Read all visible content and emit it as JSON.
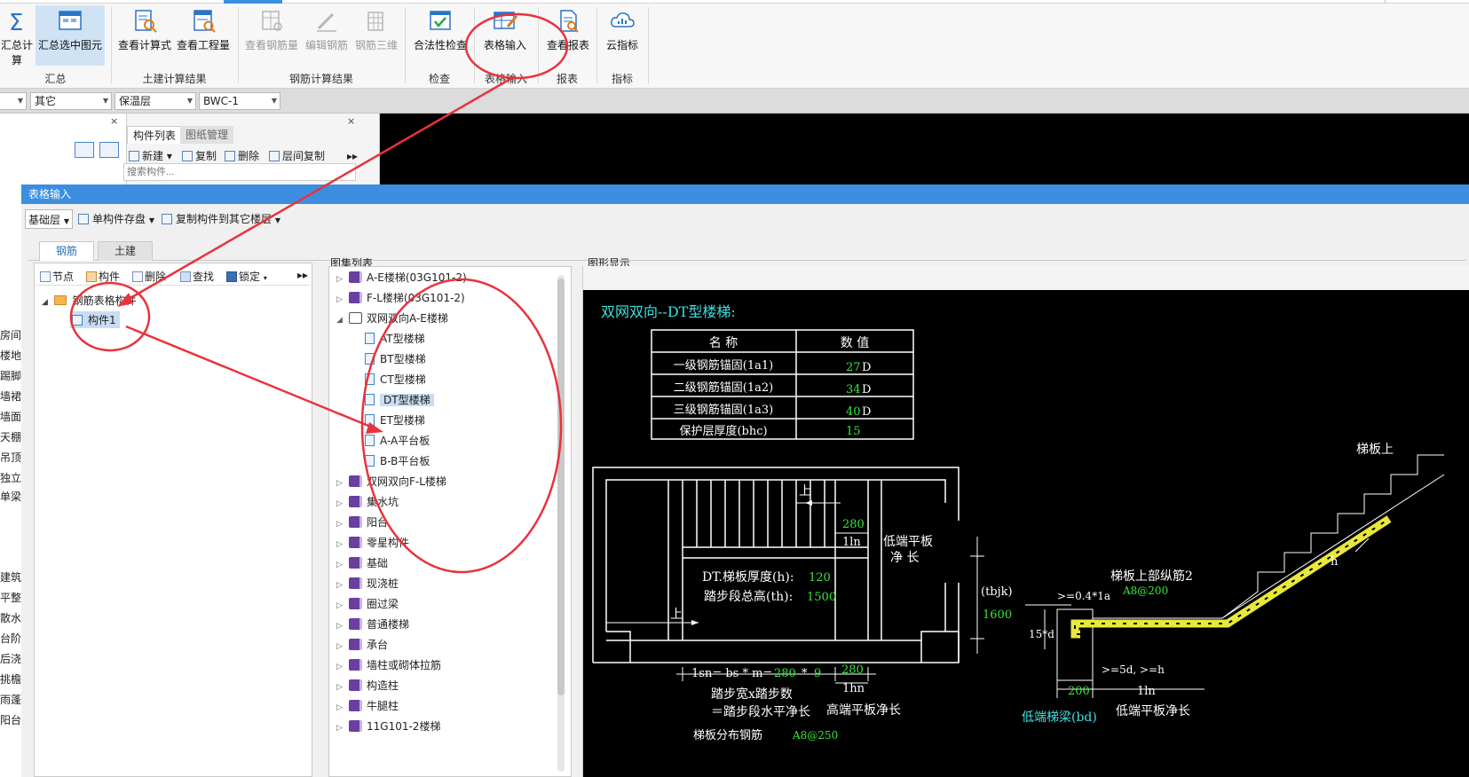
{
  "ribbon": {
    "buttons": [
      {
        "label": "汇总计算",
        "icon": "sigma-icon"
      },
      {
        "label": "汇总选中图元",
        "icon": "sum-selected-icon"
      },
      {
        "label": "查看计算式",
        "icon": "view-formula-icon"
      },
      {
        "label": "查看工程量",
        "icon": "view-quantity-icon"
      },
      {
        "label": "查看钢筋量",
        "icon": "view-rebar-icon"
      },
      {
        "label": "编辑钢筋",
        "icon": "edit-rebar-icon"
      },
      {
        "label": "钢筋三维",
        "icon": "rebar-3d-icon"
      },
      {
        "label": "合法性检查",
        "icon": "check-icon"
      },
      {
        "label": "表格输入",
        "icon": "table-input-icon"
      },
      {
        "label": "查看报表",
        "icon": "report-icon"
      },
      {
        "label": "云指标",
        "icon": "cloud-icon"
      }
    ],
    "groups": [
      "汇总",
      "土建计算结果",
      "钢筋计算结果",
      "检查",
      "表格输入",
      "报表",
      "指标"
    ]
  },
  "combos": [
    "其它",
    "保温层",
    "BWC-1"
  ],
  "component_panel": {
    "tabs": [
      "构件列表",
      "图纸管理"
    ],
    "tools": [
      "新建",
      "复制",
      "删除",
      "层间复制"
    ],
    "search_placeholder": "搜索构件..."
  },
  "side_labels": [
    "房间",
    "楼地",
    "踢脚",
    "墙裙",
    "墙面",
    "天棚",
    "吊顶",
    "独立",
    "单梁",
    "建筑",
    "平整",
    "散水",
    "台阶",
    "后浇",
    "挑檐",
    "雨蓬",
    "阳台"
  ],
  "dialog": {
    "title": "表格输入",
    "floor": "基础层",
    "toolbar": [
      "单构件存盘",
      "复制构件到其它楼层"
    ],
    "tabs": [
      "钢筋",
      "土建"
    ],
    "tree_tools": [
      "节点",
      "构件",
      "删除",
      "查找",
      "锁定"
    ],
    "tree": {
      "root": "钢筋表格构件",
      "child": "构件1"
    },
    "atlas_label": "图集列表",
    "atlas": [
      {
        "label": "A-E楼梯(03G101-2)",
        "type": "book",
        "tri": "▷"
      },
      {
        "label": "F-L楼梯(03G101-2)",
        "type": "book",
        "tri": "▷"
      },
      {
        "label": "双网双向A-E楼梯",
        "type": "openbook",
        "tri": "◢"
      },
      {
        "label": "AT型楼梯",
        "type": "page"
      },
      {
        "label": "BT型楼梯",
        "type": "page"
      },
      {
        "label": "CT型楼梯",
        "type": "page"
      },
      {
        "label": "DT型楼梯",
        "type": "page",
        "selected": true
      },
      {
        "label": "ET型楼梯",
        "type": "page"
      },
      {
        "label": "A-A平台板",
        "type": "page"
      },
      {
        "label": "B-B平台板",
        "type": "page"
      },
      {
        "label": "双网双向F-L楼梯",
        "type": "book",
        "tri": "▷"
      },
      {
        "label": "集水坑",
        "type": "book",
        "tri": "▷"
      },
      {
        "label": "阳台",
        "type": "book",
        "tri": "▷"
      },
      {
        "label": "零星构件",
        "type": "book",
        "tri": "▷"
      },
      {
        "label": "基础",
        "type": "book",
        "tri": "▷"
      },
      {
        "label": "现浇桩",
        "type": "book",
        "tri": "▷"
      },
      {
        "label": "圈过梁",
        "type": "book",
        "tri": "▷"
      },
      {
        "label": "普通楼梯",
        "type": "book",
        "tri": "▷"
      },
      {
        "label": "承台",
        "type": "book",
        "tri": "▷"
      },
      {
        "label": "墙柱或砌体拉筋",
        "type": "book",
        "tri": "▷"
      },
      {
        "label": "构造柱",
        "type": "book",
        "tri": "▷"
      },
      {
        "label": "牛腿柱",
        "type": "book",
        "tri": "▷"
      },
      {
        "label": "11G101-2楼梯",
        "type": "book",
        "tri": "▷"
      }
    ],
    "graph_label": "图形显示"
  },
  "cad": {
    "title": "双网双向--DT型楼梯:",
    "table": {
      "headers": [
        "名 称",
        "数 值"
      ],
      "rows": [
        {
          "name": "一级钢筋锚固(1a1)",
          "value": "27",
          "unit": "D"
        },
        {
          "name": "二级钢筋锚固(1a2)",
          "value": "34",
          "unit": "D"
        },
        {
          "name": "三级钢筋锚固(1a3)",
          "value": "40",
          "unit": "D"
        },
        {
          "name": "保护层厚度(bhc)",
          "value": "15",
          "unit": ""
        }
      ]
    },
    "texts": {
      "up1": "上",
      "up2": "上",
      "n280a": "280",
      "l1n_a": "1ln",
      "low_plat1": "低端平板",
      "low_plat2": "净 长",
      "thick_label": "DT.梯板厚度(h):",
      "thick_val": "120",
      "height_label": "踏步段总高(th):",
      "height_val": "1500",
      "formula_pre": "1sn= bs * m=",
      "formula_bs": "280",
      "formula_star": "*",
      "formula_m": "9",
      "n280b": "280",
      "lhn": "1hn",
      "step_desc1": "踏步宽x踏步数",
      "step_desc2": "＝踏步段水平净长",
      "high_plat": "高端平板净长",
      "tbjk": "(tbjk)",
      "v1600": "1600",
      "top_rebar": "梯板上部纵筋2",
      "a8_200": "A8@200",
      "ge04": ">=0.4*1a",
      "d15": "15*d",
      "ge5d": ">=5d, >=h",
      "v200": "200",
      "l1n_b": "1ln",
      "low_beam": "低端梯梁(bd)",
      "low_plat_len": "低端平板净长",
      "dist_rebar": "梯板分布钢筋",
      "a8_250": "A8@250",
      "h_mark": "h",
      "right_cut": "梯板上"
    }
  }
}
